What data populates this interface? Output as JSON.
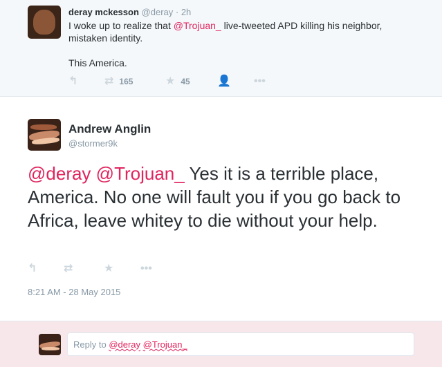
{
  "parent_tweet": {
    "name": "deray mckesson",
    "handle": "@deray",
    "time": "· 2h",
    "text_before": "I woke up to realize that ",
    "mention": "@Trojuan_",
    "text_after": " live-tweeted APD killing his neighbor, mistaken identity.",
    "text_line2": "This America.",
    "retweet_count": "165",
    "favorite_count": "45"
  },
  "main_tweet": {
    "name": "Andrew Anglin",
    "handle": "@stormer9k",
    "mention1": "@deray",
    "mention2": "@Trojuan_",
    "text": " Yes it is a terrible place, America. No one will fault you if you go back to Africa, leave whitey to die without your help.",
    "timestamp": "8:21 AM - 28 May 2015"
  },
  "reply": {
    "prefix": "Reply to ",
    "mention1": "@deray",
    "mention2": "@Trojuan_"
  },
  "icons": {
    "reply": "reply-icon",
    "retweet": "retweet-icon",
    "favorite": "star-icon",
    "follow": "follow-icon",
    "more": "more-icon"
  },
  "colors": {
    "mention": "#e0245e",
    "muted": "#8899a6",
    "reply_bg": "#f7e6ea"
  }
}
